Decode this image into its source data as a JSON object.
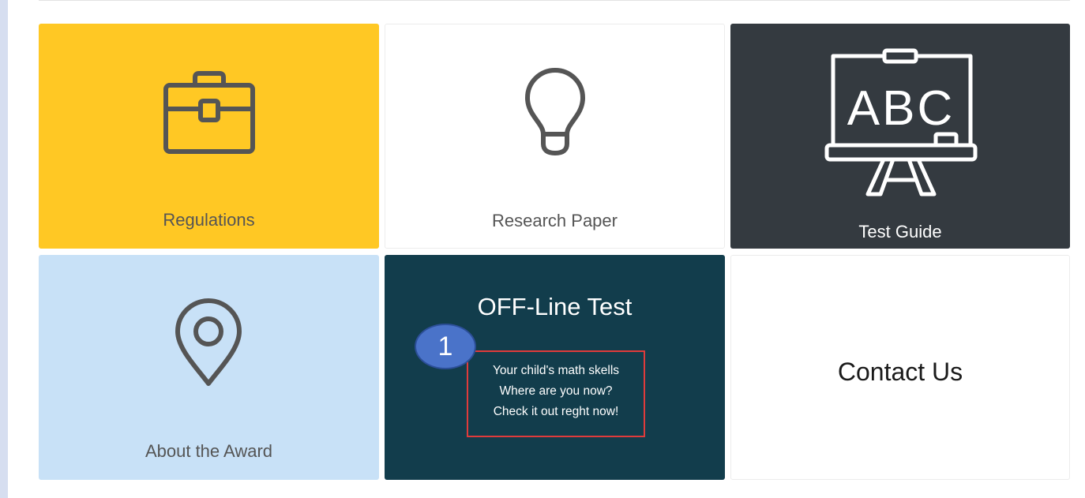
{
  "tiles": {
    "regulations": {
      "label": "Regulations",
      "icon": "briefcase-icon",
      "bg": "#ffc824"
    },
    "research": {
      "label": "Research Paper",
      "icon": "lightbulb-icon",
      "bg": "#ffffff"
    },
    "test_guide": {
      "label": "Test Guide",
      "icon": "chalkboard-abc-icon",
      "board_text": "ABC",
      "bg": "#343a40"
    },
    "about": {
      "label": "About the Award",
      "icon": "map-pin-icon",
      "bg": "#c8e1f7"
    },
    "offline": {
      "title": "OFF-Line Test",
      "lines": [
        "Your child's math skells",
        "Where are you now?",
        "Check it out reght now!"
      ],
      "badge": "1",
      "bg": "#123d4c",
      "highlight_color": "#e03b3b"
    },
    "contact": {
      "label": "Contact Us",
      "bg": "#ffffff"
    }
  }
}
